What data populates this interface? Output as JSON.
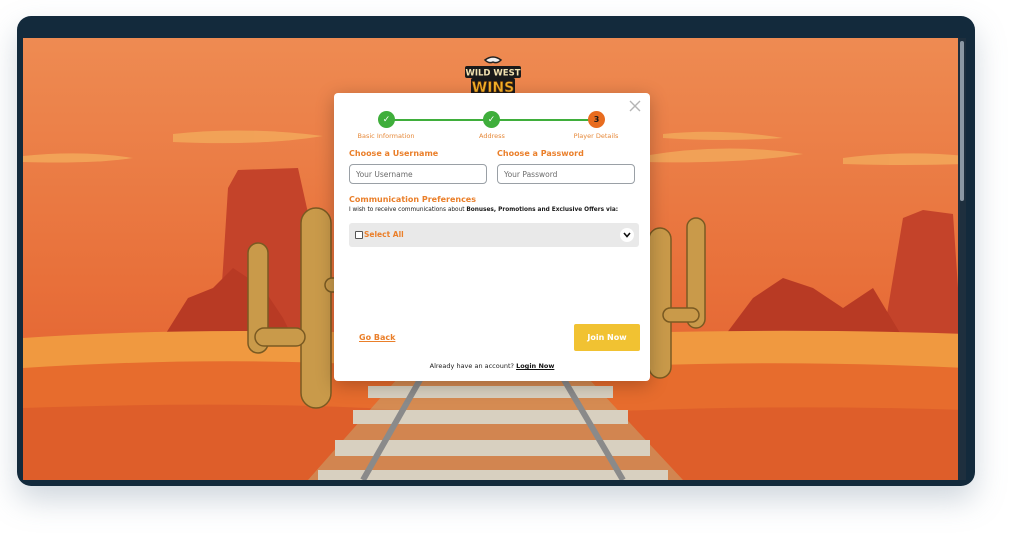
{
  "logo": {
    "line1": "WILD WEST",
    "line2": "WINS"
  },
  "stepper": {
    "steps": [
      {
        "label": "Basic Information",
        "state": "done",
        "mark": "✓"
      },
      {
        "label": "Address",
        "state": "done",
        "mark": "✓"
      },
      {
        "label": "Player Details",
        "state": "current",
        "mark": "3"
      }
    ]
  },
  "form": {
    "username_label": "Choose a Username",
    "username_placeholder": "Your Username",
    "password_label": "Choose a Password",
    "password_placeholder": "Your Password",
    "prefs_title": "Communication Preferences",
    "prefs_sub_prefix": "I wish to receive communications about ",
    "prefs_sub_bold": "Bonuses, Promotions and Exclusive Offers via:",
    "select_all_label": "Select All",
    "select_all_checked": false
  },
  "actions": {
    "go_back": "Go Back",
    "join_now": "Join Now"
  },
  "footer": {
    "already_text": "Already have an account?",
    "login_link": "Login Now"
  },
  "colors": {
    "accent_orange": "#ea7f2a",
    "step_green": "#3fae3b",
    "join_yellow": "#f1c232",
    "frame_navy": "#132a3c"
  }
}
